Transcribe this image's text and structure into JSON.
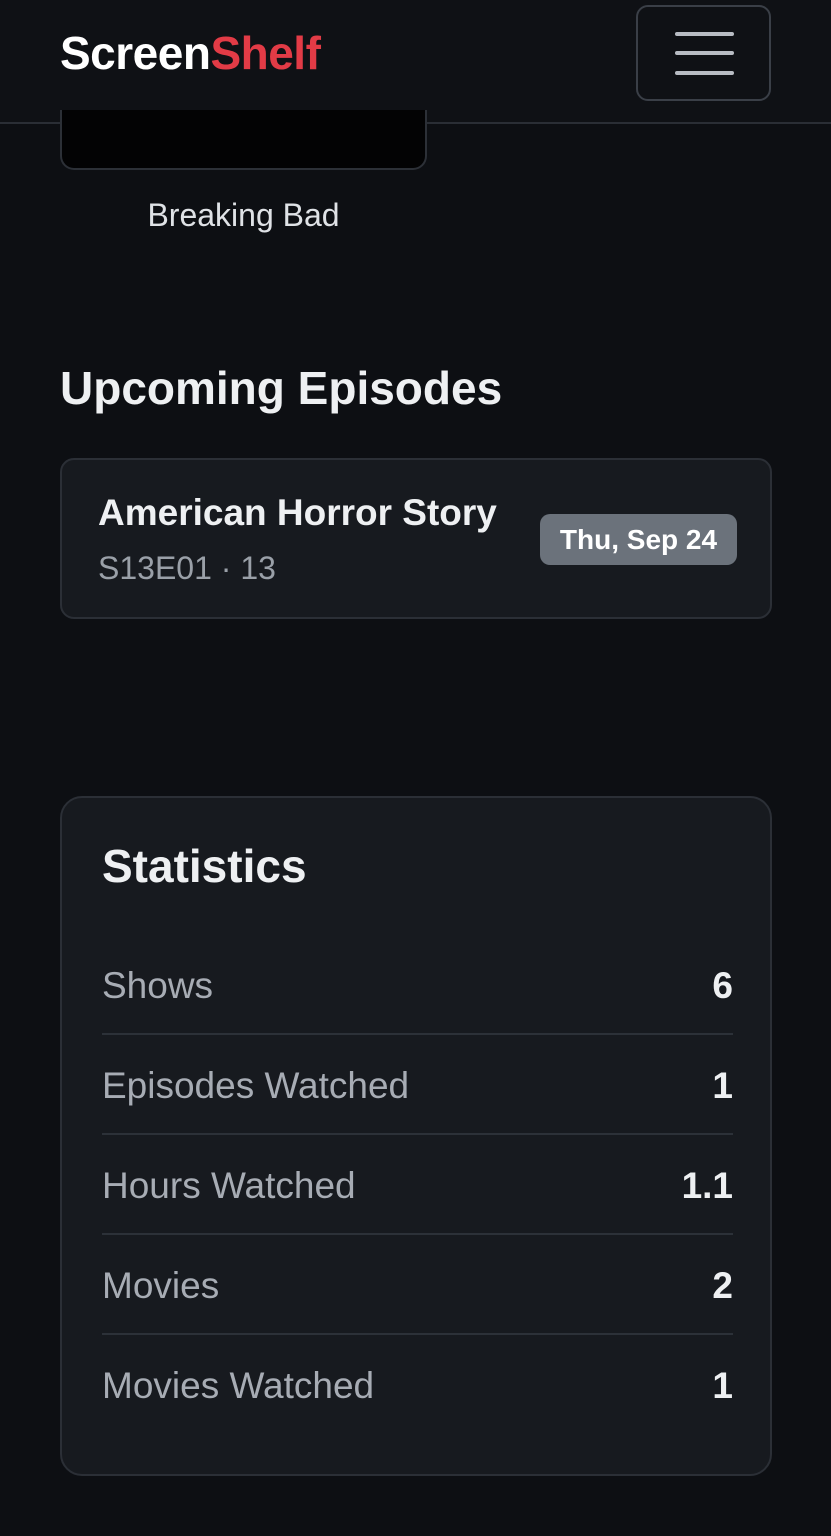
{
  "navbar": {
    "brand_part1": "Screen",
    "brand_part2": "Shelf",
    "brand_color_primary": "#ffffff",
    "brand_color_accent": "#e23b46",
    "menu_icon": "hamburger-menu-icon"
  },
  "poster": {
    "title": "Breaking Bad"
  },
  "upcoming": {
    "heading": "Upcoming Episodes",
    "episodes": [
      {
        "show": "American Horror Story",
        "meta": "S13E01 · 13",
        "date": "Thu, Sep 24"
      }
    ]
  },
  "statistics": {
    "heading": "Statistics",
    "rows": [
      {
        "label": "Shows",
        "value": "6"
      },
      {
        "label": "Episodes Watched",
        "value": "1"
      },
      {
        "label": "Hours Watched",
        "value": "1.1"
      },
      {
        "label": "Movies",
        "value": "2"
      },
      {
        "label": "Movies Watched",
        "value": "1"
      }
    ]
  }
}
